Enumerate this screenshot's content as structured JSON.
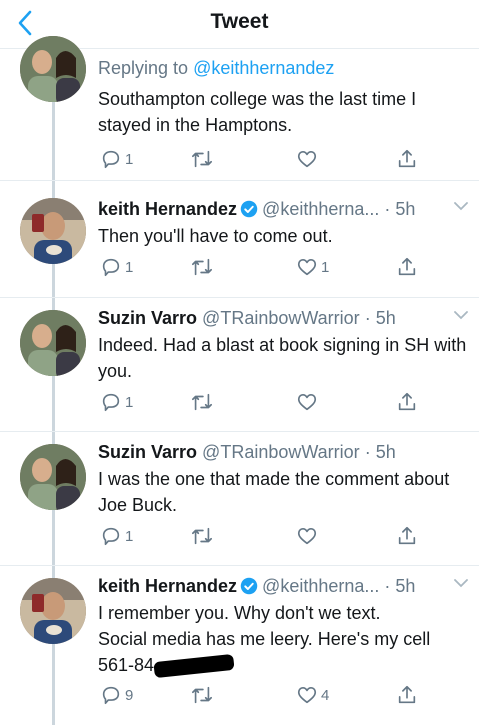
{
  "header": {
    "title": "Tweet"
  },
  "tweets": [
    {
      "reply_prefix": "Replying to ",
      "reply_to": "@keithhernandez",
      "text": "Southampton college was the last time I stayed in the Hamptons.",
      "replies": "1",
      "retweets": "",
      "likes": ""
    },
    {
      "name": "keith Hernandez",
      "verified": true,
      "handle": "@keithherna...",
      "time": "· 5h",
      "text": "Then you'll have to come out.",
      "replies": "1",
      "retweets": "",
      "likes": "1"
    },
    {
      "name": "Suzin Varro",
      "handle": "@TRainbowWarrior",
      "time": "· 5h",
      "text": "Indeed. Had a blast at book signing in SH with you.",
      "replies": "1",
      "retweets": "",
      "likes": ""
    },
    {
      "name": "Suzin Varro",
      "handle": "@TRainbowWarrior",
      "time": "· 5h",
      "text": "I was the one that made the comment about Joe Buck.",
      "replies": "1",
      "retweets": "",
      "likes": ""
    },
    {
      "name": "keith Hernandez",
      "verified": true,
      "handle": "@keithherna...",
      "time": "· 5h",
      "text_lines": [
        "I remember you.  Why don't we text.",
        "Social media has me leery. Here's my cell",
        "561-84"
      ],
      "replies": "9",
      "retweets": "",
      "likes": "4"
    }
  ],
  "icons": {
    "back": "chevron-left-icon",
    "reply": "reply-icon",
    "retweet": "retweet-icon",
    "like": "heart-icon",
    "share": "share-icon",
    "verified": "verified-badge-icon",
    "caret": "chevron-down-icon"
  },
  "colors": {
    "accent": "#1da1f2",
    "text": "#14171a",
    "muted": "#657786",
    "thread": "#ccd6dd"
  }
}
